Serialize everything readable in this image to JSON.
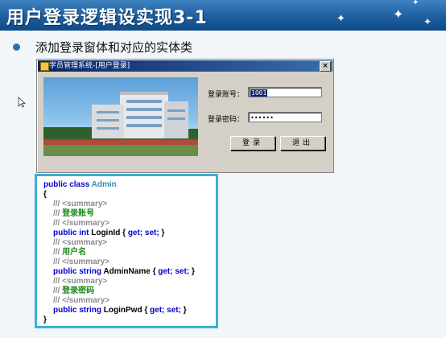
{
  "slide": {
    "title": "用户登录逻辑设实现3-1",
    "bullet": "添加登录窗体和对应的实体类"
  },
  "window": {
    "title": "学员管理系统-[用户登录]",
    "close_label": "×",
    "account_label": "登录账号：",
    "account_value": "1001",
    "password_label": "登录密码：",
    "password_value": "••••••",
    "login_button": "登录",
    "exit_button": "退出"
  },
  "code": {
    "line1_kw": "public class",
    "line1_cls": "Admin",
    "open_brace": "{",
    "summary_open": "/// <summary>",
    "summary_close": "/// </summary>",
    "comment_prefix": "///",
    "c1": "登录账号",
    "p1_kw": "public int",
    "p1_name": "LoginId",
    "p1_rest_open": "{",
    "get_set": "get; set;",
    "p1_rest_close": "}",
    "c2": "用户名",
    "p2_kw": "public string",
    "p2_name": "AdminName",
    "c3": "登录密码",
    "p3_kw": "public string",
    "p3_name": "LoginPwd",
    "close_brace": "}"
  },
  "colors": {
    "banner": "#1d5f9f",
    "code_border": "#3bb0d6",
    "keyword": "#0000cc",
    "class_name": "#2b91af",
    "comment_text": "#1a8a1a"
  }
}
